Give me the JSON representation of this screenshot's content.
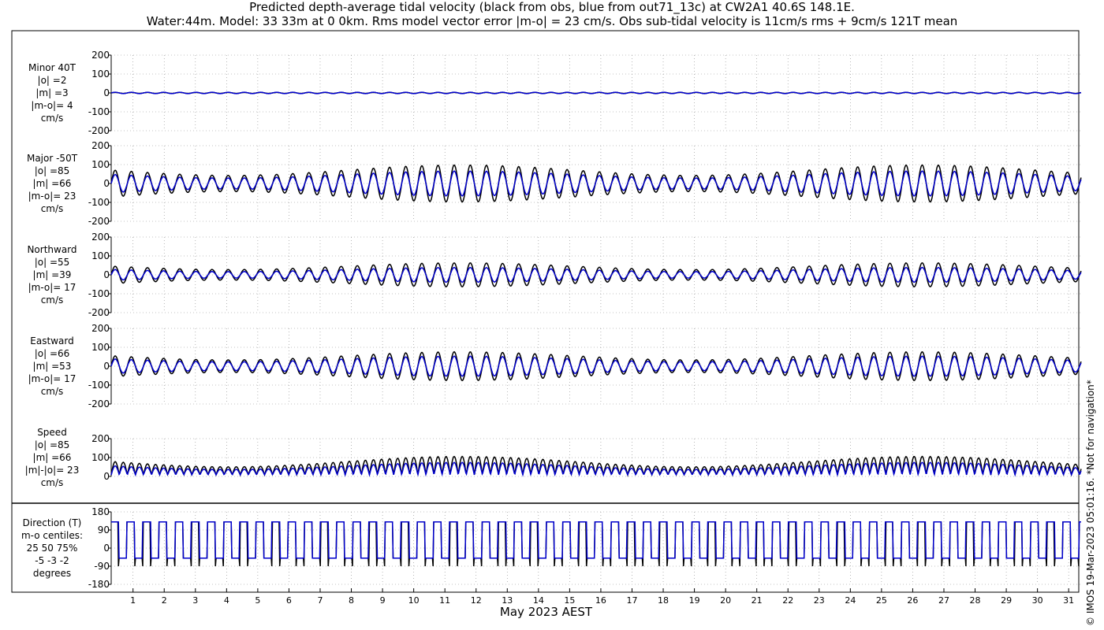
{
  "title_line1": "Predicted depth-average tidal velocity (black from obs, blue from out71_13c) at CW2A1 40.6S 148.1E.",
  "title_line2": "Water:44m. Model: 33 33m at 0 0km. Rms model vector error |m-o| = 23 cm/s. Obs sub-tidal velocity is 11cm/s rms + 9cm/s 121T mean",
  "xlabel": "May 2023 AEST",
  "copyright": "© IMOS 19-Mar-2023 05:01:16. *Not for navigation*",
  "colors": {
    "obs": "#000000",
    "model": "#0000cc",
    "grid": "#888888"
  },
  "chart_data": {
    "type": "line",
    "x_ticks": [
      "1",
      "2",
      "3",
      "4",
      "5",
      "6",
      "7",
      "8",
      "9",
      "10",
      "11",
      "12",
      "13",
      "14",
      "15",
      "16",
      "17",
      "18",
      "19",
      "20",
      "21",
      "22",
      "23",
      "24",
      "25",
      "26",
      "27",
      "28",
      "29",
      "30",
      "31"
    ],
    "xlim": [
      0.3,
      31.4
    ],
    "x_unit": "day of May 2023",
    "series_names": [
      "obs",
      "model"
    ],
    "panels": [
      {
        "label_lines": [
          "Minor 40T",
          "|o| =2",
          "|m| =3",
          "|m-o|= 4",
          "cm/s"
        ],
        "ylim": [
          -200,
          200
        ],
        "yticks": [
          "200",
          "100",
          "0",
          "-100",
          "-200"
        ],
        "ytick_values": [
          200,
          100,
          0,
          -100,
          -200
        ],
        "kind": "minor",
        "obs_amp": 2,
        "model_amp": 3
      },
      {
        "label_lines": [
          "Major -50T",
          "|o| =85",
          "|m| =66",
          "|m-o|= 23",
          "cm/s"
        ],
        "ylim": [
          -200,
          200
        ],
        "yticks": [
          "200",
          "100",
          "0",
          "-100",
          "-200"
        ],
        "ytick_values": [
          200,
          100,
          0,
          -100,
          -200
        ],
        "kind": "sine",
        "obs_amp": 85,
        "model_amp": 66
      },
      {
        "label_lines": [
          "Northward",
          "|o| =55",
          "|m| =39",
          "|m-o|= 17",
          "cm/s"
        ],
        "ylim": [
          -200,
          200
        ],
        "yticks": [
          "200",
          "100",
          "0",
          "-100",
          "-200"
        ],
        "ytick_values": [
          200,
          100,
          0,
          -100,
          -200
        ],
        "kind": "sine",
        "obs_amp": 55,
        "model_amp": 39
      },
      {
        "label_lines": [
          "Eastward",
          "|o| =66",
          "|m| =53",
          "|m-o|= 17",
          "cm/s"
        ],
        "ylim": [
          -200,
          200
        ],
        "yticks": [
          "200",
          "100",
          "0",
          "-100",
          "-200"
        ],
        "ytick_values": [
          200,
          100,
          0,
          -100,
          -200
        ],
        "kind": "sine",
        "obs_amp": 66,
        "model_amp": 53
      },
      {
        "label_lines": [
          "Speed",
          "|o| =85",
          "|m| =66",
          "|m|-|o|= 23",
          "cm/s"
        ],
        "ylim": [
          0,
          200
        ],
        "yticks": [
          "200",
          "100",
          "0"
        ],
        "ytick_values": [
          200,
          100,
          0
        ],
        "kind": "speed",
        "obs_amp": 85,
        "model_amp": 66
      },
      {
        "label_lines": [
          "Direction (T)",
          "m-o centiles:",
          "25  50  75%",
          "-5 -3 -2",
          "degrees"
        ],
        "ylim": [
          -180,
          180
        ],
        "yticks": [
          "180",
          "90",
          "0",
          "-90",
          "-180"
        ],
        "ytick_values": [
          180,
          90,
          0,
          -90,
          -180
        ],
        "kind": "direction",
        "dir_high": 130,
        "dir_low": -50
      }
    ]
  }
}
